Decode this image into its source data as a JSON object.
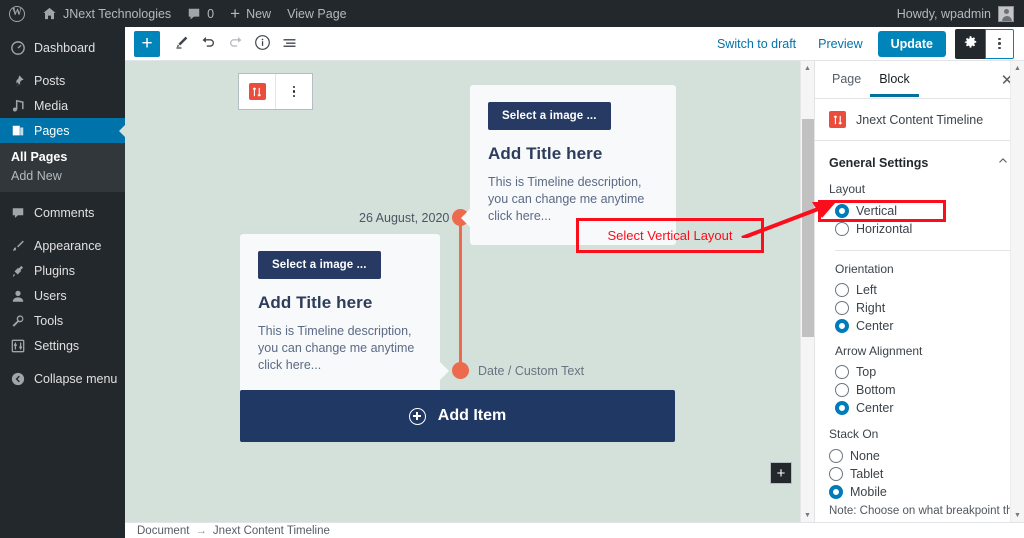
{
  "adminbar": {
    "logo_icon": "wordpress-logo-icon",
    "site_icon": "home-icon",
    "site_name": "JNext Technologies",
    "comments_icon": "comment-bubble-icon",
    "comments_count": "0",
    "new_icon": "plus-icon",
    "new_label": "New",
    "view_page_label": "View Page",
    "howdy": "Howdy, wpadmin",
    "avatar": "user-avatar"
  },
  "adminmenu": {
    "items": [
      {
        "label": "Dashboard",
        "icon": "dashboard-icon",
        "current": false
      },
      {
        "label": "Posts",
        "icon": "pin-icon",
        "current": false
      },
      {
        "label": "Media",
        "icon": "media-icon",
        "current": false
      },
      {
        "label": "Pages",
        "icon": "pages-icon",
        "current": true
      },
      {
        "label": "Comments",
        "icon": "comment-bubble-icon",
        "current": false
      },
      {
        "label": "Appearance",
        "icon": "brush-icon",
        "current": false
      },
      {
        "label": "Plugins",
        "icon": "plug-icon",
        "current": false
      },
      {
        "label": "Users",
        "icon": "user-icon",
        "current": false
      },
      {
        "label": "Tools",
        "icon": "wrench-icon",
        "current": false
      },
      {
        "label": "Settings",
        "icon": "settings-sliders-icon",
        "current": false
      },
      {
        "label": "Collapse menu",
        "icon": "collapse-arrow-icon",
        "current": false
      }
    ],
    "submenu": [
      {
        "label": "All Pages",
        "current": true
      },
      {
        "label": "Add New",
        "current": false
      }
    ]
  },
  "editor_header": {
    "inserter_icon": "plus-icon",
    "pen_icon": "pencil-icon",
    "undo_icon": "undo-arrow-icon",
    "redo_icon": "redo-arrow-icon",
    "info_icon": "info-circle-icon",
    "outline_icon": "block-navigation-icon",
    "switch_to_draft": "Switch to draft",
    "preview": "Preview",
    "update": "Update",
    "gear_icon": "gear-icon",
    "more_icon": "vertical-dots-icon"
  },
  "block_toolbar": {
    "block_icon": "jnext-timeline-icon",
    "more_icon": "vertical-dots-icon"
  },
  "canvas": {
    "appender_label": "+",
    "timeline": {
      "items": [
        {
          "date": "26 August, 2020",
          "image_button": "Select a image ...",
          "title": "Add Title here",
          "description": "This is Timeline description, you can change me anytime click here...",
          "side": "right"
        },
        {
          "date": "Date / Custom Text",
          "image_button": "Select a image ...",
          "title": "Add Title here",
          "description": "This is Timeline description, you can change me anytime click here...",
          "side": "left"
        }
      ],
      "add_item_label": "Add Item",
      "add_item_icon": "plus-circle-icon",
      "line_color": "#ed6a4c",
      "card_bg": "#f8f9fb",
      "canvas_bg": "#d3e1da"
    }
  },
  "settings_sidebar": {
    "tabs": [
      {
        "label": "Page",
        "active": false
      },
      {
        "label": "Block",
        "active": true
      }
    ],
    "close_icon": "close-icon",
    "block_title": "Jnext Content Timeline",
    "block_icon": "jnext-timeline-icon",
    "panel": {
      "title": "General Settings",
      "chevron_icon": "chevron-up-icon",
      "groups": [
        {
          "label": "Layout",
          "options": [
            {
              "label": "Vertical",
              "checked": true
            },
            {
              "label": "Horizontal",
              "checked": false
            }
          ]
        },
        {
          "label": "Orientation",
          "options": [
            {
              "label": "Left",
              "checked": false
            },
            {
              "label": "Right",
              "checked": false
            },
            {
              "label": "Center",
              "checked": true
            }
          ]
        },
        {
          "label": "Arrow Alignment",
          "options": [
            {
              "label": "Top",
              "checked": false
            },
            {
              "label": "Bottom",
              "checked": false
            },
            {
              "label": "Center",
              "checked": true
            }
          ]
        },
        {
          "label": "Stack On",
          "options": [
            {
              "label": "None",
              "checked": false
            },
            {
              "label": "Tablet",
              "checked": false
            },
            {
              "label": "Mobile",
              "checked": true
            }
          ]
        }
      ],
      "note": "Note: Choose on what breakpoint the columns"
    }
  },
  "breadcrumb": {
    "root": "Document",
    "separator": "→",
    "current": "Jnext Content Timeline"
  },
  "annotation": {
    "text": "Select Vertical Layout",
    "color": "#fc0d1b"
  }
}
